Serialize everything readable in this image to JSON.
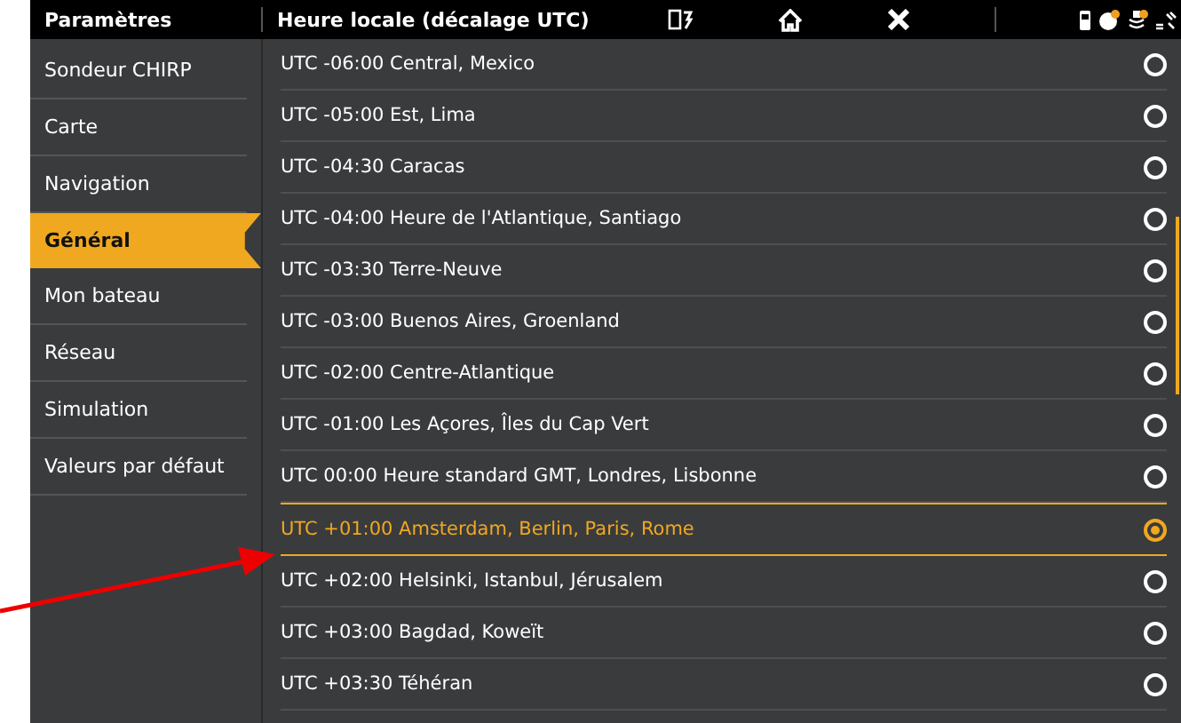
{
  "header": {
    "title": "Paramètres",
    "subtitle": "Heure locale (décalage UTC)"
  },
  "sidebar": {
    "items": [
      {
        "label": "Sondeur CHIRP",
        "selected": false
      },
      {
        "label": "Carte",
        "selected": false
      },
      {
        "label": "Navigation",
        "selected": false
      },
      {
        "label": "Général",
        "selected": true
      },
      {
        "label": "Mon bateau",
        "selected": false
      },
      {
        "label": "Réseau",
        "selected": false
      },
      {
        "label": "Simulation",
        "selected": false
      },
      {
        "label": "Valeurs par défaut",
        "selected": false
      }
    ]
  },
  "timezones": [
    {
      "label": "UTC -06:00 Central, Mexico",
      "selected": false
    },
    {
      "label": "UTC -05:00 Est, Lima",
      "selected": false
    },
    {
      "label": "UTC -04:30 Caracas",
      "selected": false
    },
    {
      "label": "UTC -04:00 Heure de l'Atlantique, Santiago",
      "selected": false
    },
    {
      "label": "UTC -03:30 Terre-Neuve",
      "selected": false
    },
    {
      "label": "UTC -03:00 Buenos Aires, Groenland",
      "selected": false
    },
    {
      "label": "UTC -02:00 Centre-Atlantique",
      "selected": false
    },
    {
      "label": "UTC -01:00 Les Açores, Îles du Cap Vert",
      "selected": false
    },
    {
      "label": "UTC 00:00 Heure standard GMT, Londres, Lisbonne",
      "selected": false
    },
    {
      "label": "UTC +01:00 Amsterdam, Berlin, Paris, Rome",
      "selected": true
    },
    {
      "label": "UTC +02:00 Helsinki, Istanbul, Jérusalem",
      "selected": false
    },
    {
      "label": "UTC +03:00 Bagdad, Koweït",
      "selected": false
    },
    {
      "label": "UTC +03:30 Téhéran",
      "selected": false
    }
  ]
}
